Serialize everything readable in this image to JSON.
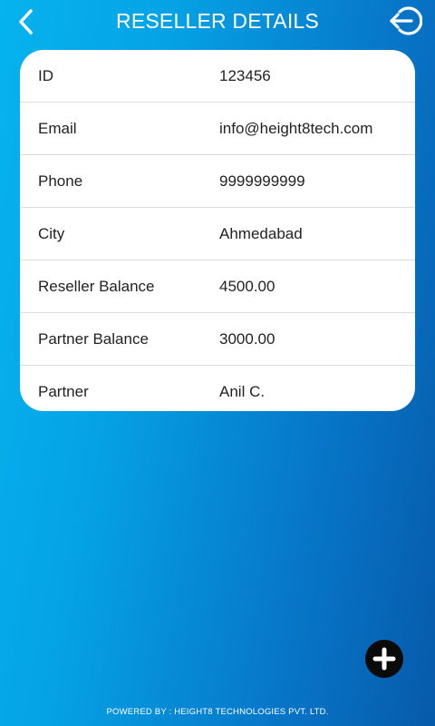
{
  "header": {
    "title": "RESELLER DETAILS",
    "back_icon": "chevron-left-icon",
    "logout_icon": "logout-icon"
  },
  "details": [
    {
      "label": "ID",
      "value": "123456"
    },
    {
      "label": "Email",
      "value": "info@height8tech.com"
    },
    {
      "label": "Phone",
      "value": "9999999999"
    },
    {
      "label": "City",
      "value": "Ahmedabad"
    },
    {
      "label": "Reseller Balance",
      "value": "4500.00"
    },
    {
      "label": "Partner Balance",
      "value": "3000.00"
    },
    {
      "label": "Partner",
      "value": "Anil C."
    }
  ],
  "fab": {
    "icon": "plus-icon"
  },
  "footer": {
    "text": "POWERED BY : HEIGHT8 TECHNOLOGIES PVT. LTD."
  },
  "colors": {
    "gradient_start": "#06b3ee",
    "gradient_end": "#075aaa",
    "card_bg": "#ffffff",
    "fab_bg": "#0a0a0a"
  }
}
